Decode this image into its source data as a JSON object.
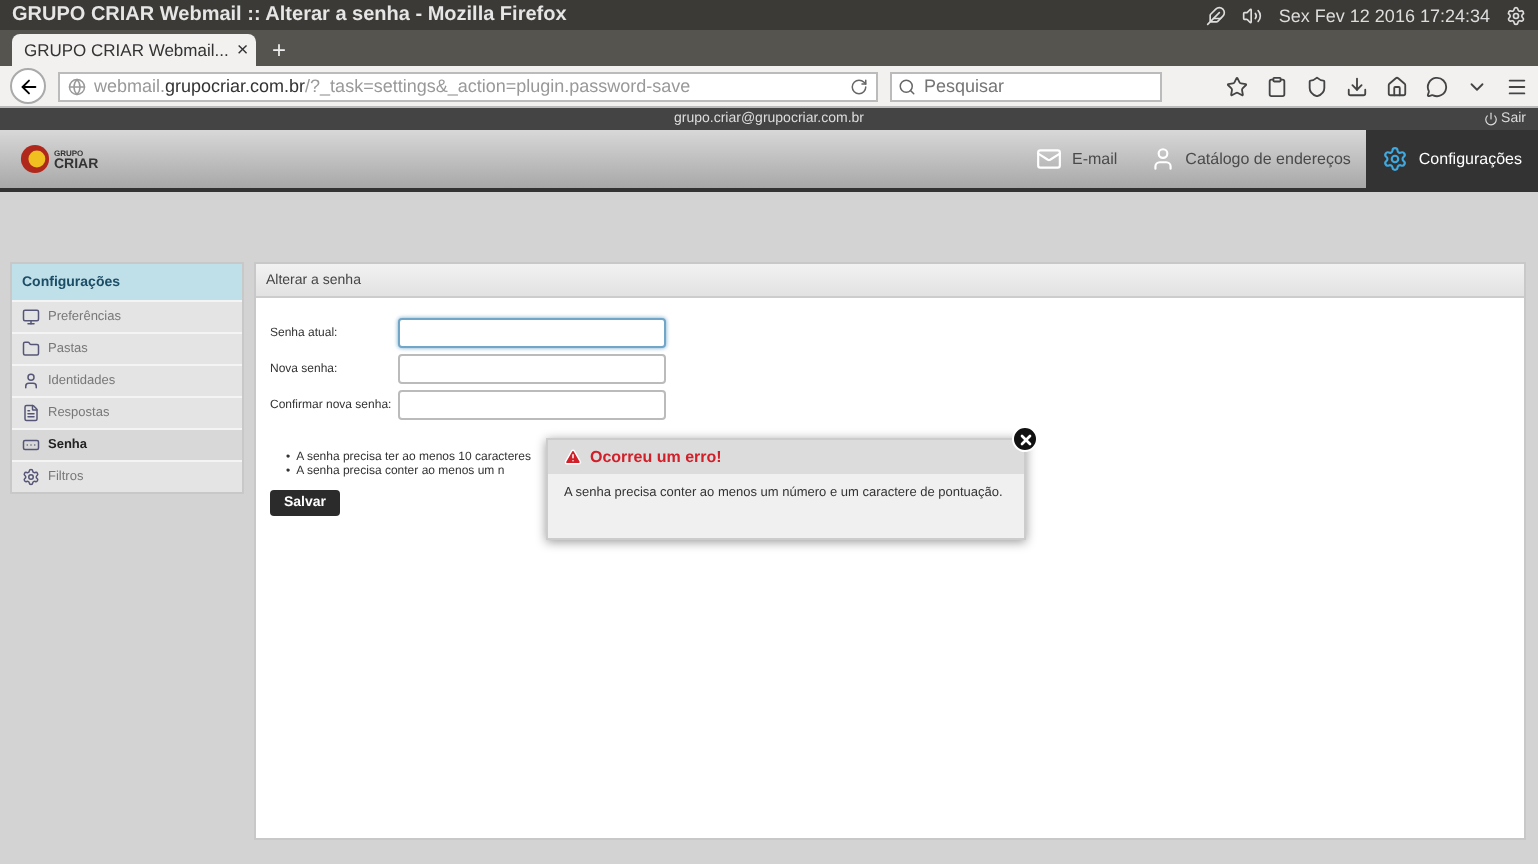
{
  "os_bar": {
    "window_title": "GRUPO CRIAR Webmail :: Alterar a senha - Mozilla Firefox",
    "clock": "Sex Fev 12 2016 17:24:34"
  },
  "browser": {
    "tab_title": "GRUPO CRIAR Webmail...",
    "tab_close": "×",
    "new_tab": "+",
    "url": "webmail.**grupocriar.com.br**/?_task=settings&_action=plugin.password-save",
    "search": {
      "placeholder": "Pesquisar"
    }
  },
  "top_line": {
    "user": "grupo.criar@grupocriar.com.br",
    "logout": "Sair"
  },
  "header": {
    "logo_top": "GRUPO",
    "logo_bottom": "CRIAR",
    "nav": [
      {
        "label": "E-mail",
        "selected": false
      },
      {
        "label": "Catálogo de endereços",
        "selected": false
      },
      {
        "label": "Configurações",
        "selected": true
      }
    ]
  },
  "sidebar": {
    "title": "Configurações",
    "items": [
      {
        "label": "Preferências",
        "selected": false
      },
      {
        "label": "Pastas",
        "selected": false
      },
      {
        "label": "Identidades",
        "selected": false
      },
      {
        "label": "Respostas",
        "selected": false
      },
      {
        "label": "Senha",
        "selected": true
      },
      {
        "label": "Filtros",
        "selected": false
      }
    ]
  },
  "panel": {
    "title": "Alterar a senha",
    "fields": [
      {
        "label": "Senha atual:",
        "focused": true
      },
      {
        "label": "Nova senha:",
        "focused": false
      },
      {
        "label": "Confirmar nova senha:",
        "focused": false
      }
    ],
    "rules": [
      {
        "marker": "•",
        "text": "A senha precisa ter ao menos 10 caracteres"
      },
      {
        "marker": "•",
        "text": "A senha precisa conter ao menos um n"
      }
    ],
    "submit": "Salvar"
  },
  "dialog": {
    "title": "Ocorreu um erro!",
    "message": "A senha precisa conter ao menos um número e um caractere de pontuação."
  }
}
